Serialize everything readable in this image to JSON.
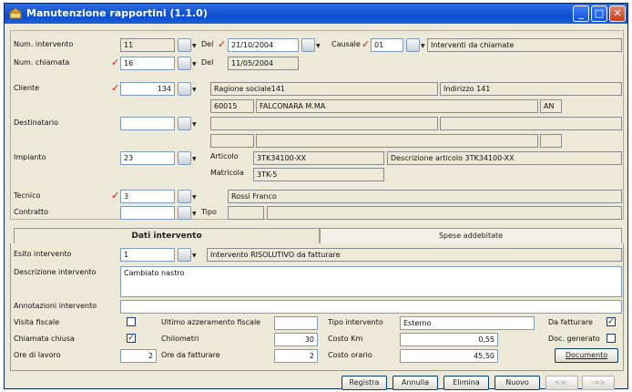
{
  "window": {
    "title": "Manutenzione rapportini (1.1.0)",
    "controls": {
      "minimize": "_",
      "maximize": "□",
      "close": "✕"
    }
  },
  "header": {
    "num_intervento": {
      "label": "Num. intervento",
      "value": "11"
    },
    "del1": {
      "label": "Del",
      "value": "21/10/2004"
    },
    "causale": {
      "label": "Causale",
      "code": "01",
      "description": "Interventi da chiamate"
    },
    "num_chiamata": {
      "label": "Num. chiamata",
      "value": "16"
    },
    "del2": {
      "label": "Del",
      "value": "11/05/2004"
    }
  },
  "cliente": {
    "label": "Cliente",
    "code": "134",
    "ragione_sociale": "Ragione sociale141",
    "indirizzo": "Indirizzo 141",
    "cap": "60015",
    "citta": "FALCONARA M.MA",
    "provincia": "AN"
  },
  "destinatario": {
    "label": "Destinatario",
    "code": ""
  },
  "impianto": {
    "label": "Impianto",
    "code": "23",
    "articolo_label": "Articolo",
    "articolo": "3TK34100-XX",
    "descrizione": "Descrizione articolo 3TK34100-XX",
    "matricola_label": "Matricola",
    "matricola": "3TK-5"
  },
  "tecnico": {
    "label": "Tecnico",
    "code": "3",
    "name": "Rossi Franco"
  },
  "contratto": {
    "label": "Contratto",
    "code": "",
    "tipo_label": "Tipo"
  },
  "tabs": [
    {
      "label": "Dati intervento",
      "active": true
    },
    {
      "label": "Spese addebitate",
      "active": false
    }
  ],
  "dati": {
    "esito": {
      "label": "Esito intervento",
      "code": "1",
      "description": "Intervento RISOLUTIVO da fatturare"
    },
    "descrizione": {
      "label": "Descrizione intervento",
      "value": "Cambiato nastro"
    },
    "annotazioni": {
      "label": "Annotazioni intervento",
      "value": ""
    },
    "visita_fiscale": {
      "label": "Visita fiscale",
      "checked": false
    },
    "chiamata_chiusa": {
      "label": "Chiamata chiusa",
      "checked": true
    },
    "ore_lavoro": {
      "label": "Ore di lavoro",
      "value": "2"
    },
    "ultimo_azzeramento": {
      "label": "Ultimo azzeramento fiscale",
      "value": ""
    },
    "chilometri": {
      "label": "Chilometri",
      "value": "30"
    },
    "ore_fatturare": {
      "label": "Ore da fatturare",
      "value": "2"
    },
    "tipo_intervento": {
      "label": "Tipo intervento",
      "value": "Esterno"
    },
    "costo_km": {
      "label": "Costo Km",
      "value": "0,55"
    },
    "costo_orario": {
      "label": "Costo orario",
      "value": "45,50"
    },
    "da_fatturare": {
      "label": "Da fatturare",
      "checked": true
    },
    "doc_generato": {
      "label": "Doc. generato",
      "checked": false
    },
    "documento_button": "Documento"
  },
  "footer": {
    "registra": "Registra",
    "annulla": "Annulla",
    "elimina": "Elimina",
    "nuovo": "Nuovo",
    "prev": "<<-",
    "next": "->>"
  }
}
